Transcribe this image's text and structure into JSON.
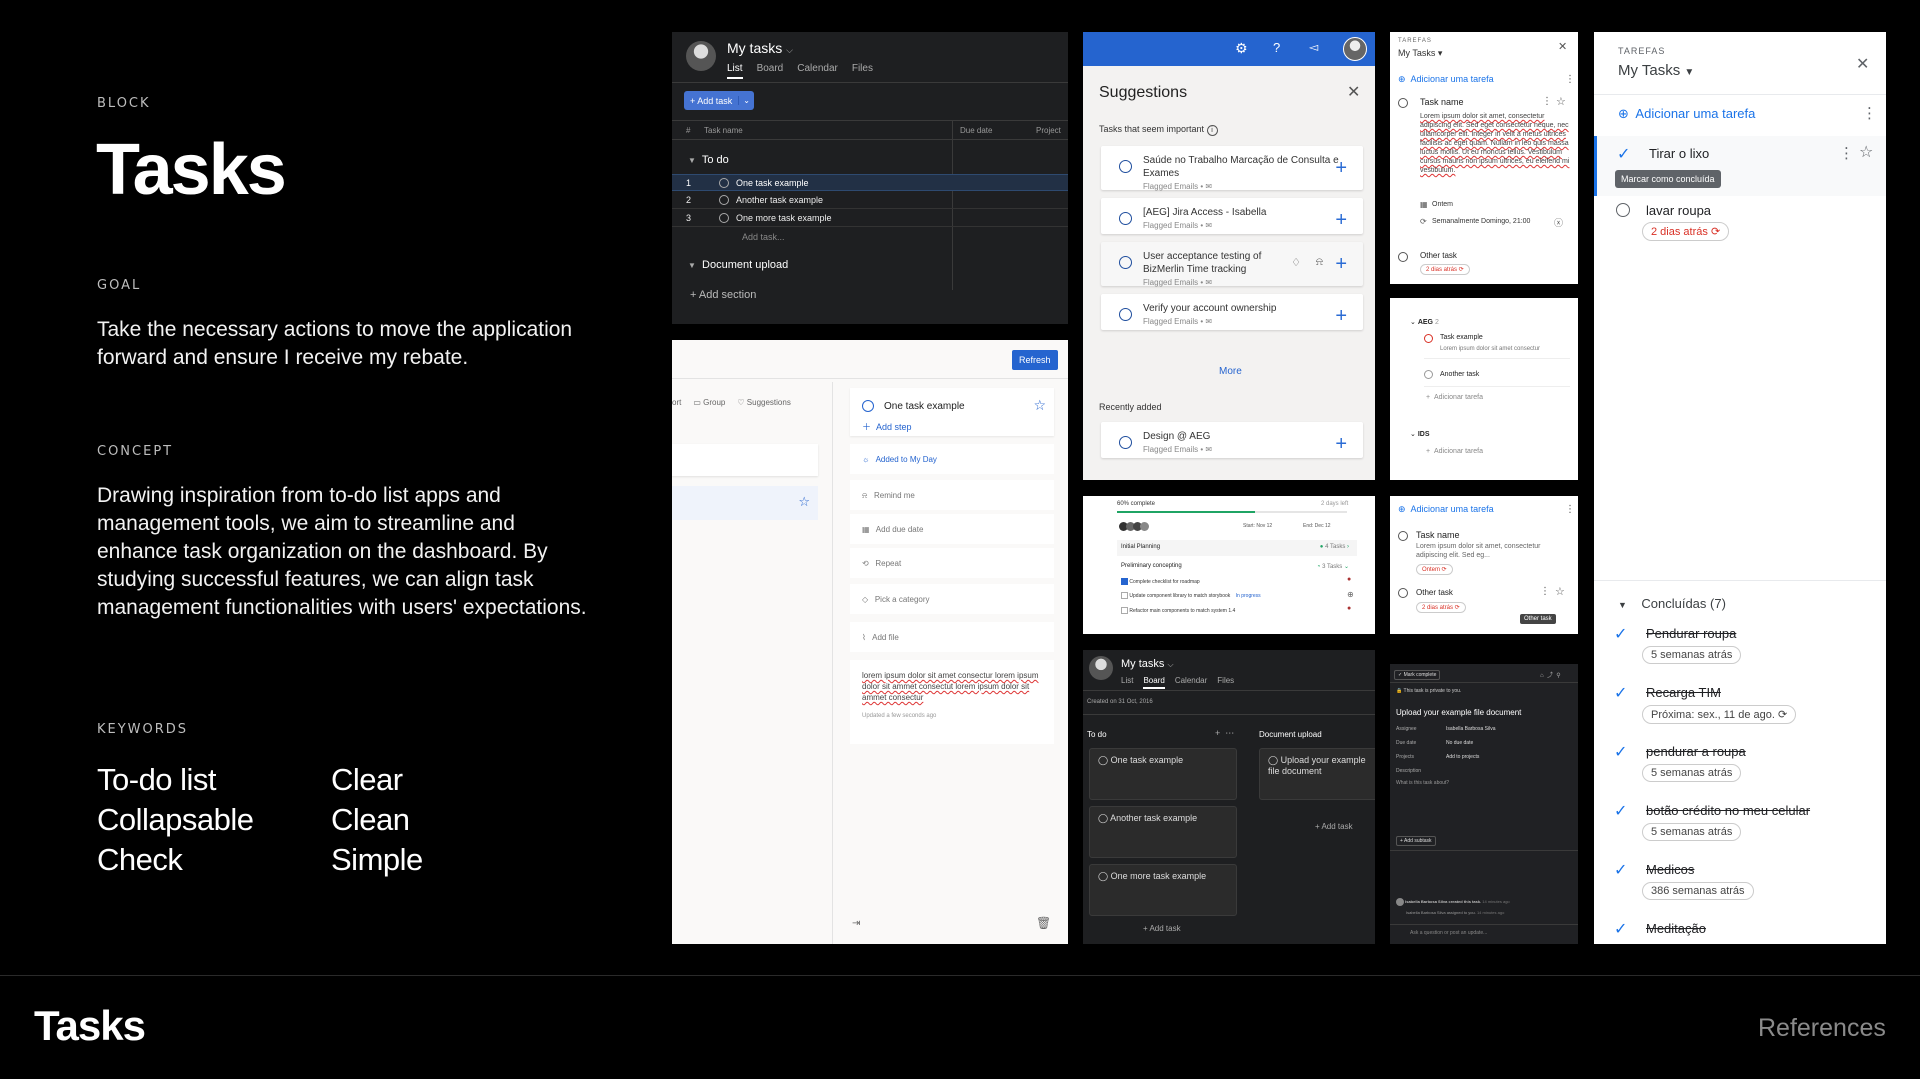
{
  "left": {
    "block_label": "BLOCK",
    "title": "Tasks",
    "goal_label": "GOAL",
    "goal_text": "Take the necessary actions to move the application forward and ensure I receive my rebate.",
    "concept_label": "CONCEPT",
    "concept_text": "Drawing inspiration from to-do list apps and management tools, we aim to streamline and enhance task organization on the dashboard. By studying successful features, we can align task management functionalities with users' expectations.",
    "keywords_label": "KEYWORDS",
    "keywords_col1": [
      "To-do list",
      "Collapsable",
      "Check"
    ],
    "keywords_col2": [
      "Clear",
      "Clean",
      "Simple"
    ]
  },
  "footer": {
    "title": "Tasks",
    "references": "References"
  },
  "asana_list": {
    "title": "My tasks",
    "tabs": [
      "List",
      "Board",
      "Calendar",
      "Files"
    ],
    "add_task": "+ Add task",
    "col_num": "#",
    "col_name": "Task name",
    "col_due": "Due date",
    "col_proj": "Project",
    "section1": "To do",
    "tasks": [
      {
        "n": "1",
        "name": "One task example"
      },
      {
        "n": "2",
        "name": "Another task example"
      },
      {
        "n": "3",
        "name": "One more task example"
      }
    ],
    "add_task_inline": "Add task...",
    "section2": "Document upload",
    "add_section": "+ Add section"
  },
  "ms_detail": {
    "refresh": "Refresh",
    "tool_sort": "ort",
    "tool_group": "Group",
    "tool_suggestions": "Suggestions",
    "task": "One task example",
    "add_step": "Add step",
    "added_my_day": "Added to My Day",
    "remind": "Remind me",
    "due": "Add due date",
    "repeat": "Repeat",
    "category": "Pick a category",
    "file": "Add file",
    "note": "lorem ipsum dolor sit amet consectur lorem ipsum dolor sit ammet consectut lorem ipsum dolor sit ammet consectur",
    "updated": "Updated a few seconds ago"
  },
  "suggestions": {
    "title": "Suggestions",
    "important": "Tasks that seem important",
    "items": [
      {
        "title": "Saúde no Trabalho Marcação de Consulta e Exames",
        "sub": "Flagged Emails  •"
      },
      {
        "title": "[AEG] Jira Access - Isabella",
        "sub": "Flagged Emails  •"
      },
      {
        "title": "User acceptance testing of BizMerlin Time tracking",
        "sub": "Flagged Emails  •"
      },
      {
        "title": "Verify your account ownership",
        "sub": "Flagged Emails  •"
      }
    ],
    "more": "More",
    "recent": "Recently added",
    "recent_item": {
      "title": "Design @ AEG",
      "sub": "Flagged Emails  •"
    }
  },
  "gtasks_small": {
    "header": "TAREFAS",
    "list": "My Tasks",
    "add": "Adicionar uma tarefa",
    "task_name": "Task name",
    "lorem": "Lorem ipsum dolor sit amet, consectetur adipiscing elit. Sed eget consectetur neque, nec ullamcorper elit. Integer in velit a metus ultrices facilisis ac eget quam. Nullam in leo quis massa luctus mollis. Ut eu rhoncus tellus. Vestibulum cursus mauris non ipsum ultrices, eu eleifend mi vestibulum.",
    "date": "Ontem",
    "repeat": "Semanalmente Domingo, 21:00",
    "other": "Other task",
    "other_chip": "2 dias atrás"
  },
  "aeg_panel": {
    "group1": "AEG",
    "group1_count": "2",
    "task1": "Task example",
    "task1_sub": "Lorem ipsum dolor sit amet consectur",
    "task2": "Another task",
    "add": "Adicionar tarefa",
    "group2": "IDS",
    "add2": "Adicionar tarefa"
  },
  "progress_panel": {
    "complete": "60% complete",
    "days_left": "2 days left",
    "start": "Start: Nov 12",
    "end": "End: Dec 12",
    "initial": "Initial Planning",
    "initial_tasks": "4 Tasks",
    "prelim": "Preliminary concepting",
    "prelim_tasks": "3 Tasks",
    "sub1": "Complete checklist for roadmap",
    "sub2": "Update component library to match storybook",
    "sub2_tag": "In progress",
    "sub3": "Refactor main components to match system 1.4",
    "progress": 60
  },
  "gtasks_medium": {
    "add": "Adicionar uma tarefa",
    "task": "Task name",
    "desc": "Lorem ipsum dolor sit amet, consectetur adipiscing elit. Sed eg...",
    "date": "Ontem",
    "other": "Other task",
    "other_chip": "2 dias atrás",
    "tooltip": "Other task"
  },
  "asana_board": {
    "title": "My tasks",
    "tabs": [
      "List",
      "Board",
      "Calendar",
      "Files"
    ],
    "created": "Created on 31 Oct, 2016",
    "col1": "To do",
    "col2": "Document upload",
    "cards1": [
      "One task example",
      "Another task example",
      "One more task example"
    ],
    "card2": "Upload your example file document",
    "add_task": "+ Add task"
  },
  "asana_detail": {
    "mark": "✓ Mark complete",
    "private": "This task is private to you.",
    "title": "Upload your example file document",
    "assignee_label": "Assignee",
    "assignee": "Isabella Barbosa Silva",
    "due_label": "Due date",
    "due": "No due date",
    "projects_label": "Projects",
    "projects": "Add to projects",
    "desc_label": "Description",
    "desc": "What is this task about?",
    "subtask": "+ Add subtask",
    "activity1": "Isabella Barbosa Silva created this task.",
    "activity1_time": "14 minutes ago",
    "activity2": "Isabella Barbosa Silva assigned to you.",
    "activity2_time": "14 minutes ago",
    "comment": "Ask a question or post an update..."
  },
  "gtasks_large": {
    "header": "TAREFAS",
    "list": "My Tasks",
    "add": "Adicionar uma tarefa",
    "task1": "Tirar o lixo",
    "tooltip": "Marcar como concluída",
    "task2": "lavar roupa",
    "task2_chip": "2 dias atrás",
    "completed": "Concluídas (7)",
    "done": [
      {
        "title": "Pendurar roupa",
        "chip": "5 semanas atrás"
      },
      {
        "title": "Recarga TIM",
        "chip": "Próxima: sex., 11 de ago."
      },
      {
        "title": "pendurar a roupa",
        "chip": "5 semanas atrás"
      },
      {
        "title": "botão crédito no meu celular",
        "chip": "5 semanas atrás"
      },
      {
        "title": "Medicos",
        "chip": "386 semanas atrás"
      },
      {
        "title": "Meditação",
        "chip": ""
      }
    ]
  }
}
